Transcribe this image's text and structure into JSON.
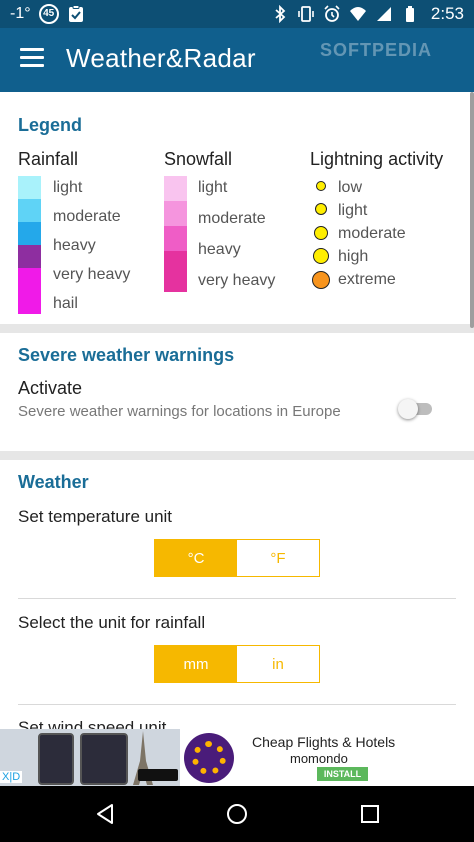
{
  "status_bar": {
    "temperature": "-1°",
    "notification_count": "45",
    "time": "2:53"
  },
  "app_bar": {
    "title": "Weather&Radar",
    "watermark": "SOFTPEDIA"
  },
  "legend": {
    "title": "Legend",
    "rainfall": {
      "title": "Rainfall",
      "items": [
        {
          "label": "light",
          "color": "#a9f2fb"
        },
        {
          "label": "moderate",
          "color": "#5fd3f6"
        },
        {
          "label": "heavy",
          "color": "#24a8ea"
        },
        {
          "label": "very heavy",
          "color": "#8e2ea0"
        },
        {
          "label": "hail",
          "color": "#f01ae8"
        }
      ]
    },
    "snowfall": {
      "title": "Snowfall",
      "items": [
        {
          "label": "light",
          "color": "#f9c4ef"
        },
        {
          "label": "moderate",
          "color": "#f595de"
        },
        {
          "label": "heavy",
          "color": "#ef5dc6"
        },
        {
          "label": "very heavy",
          "color": "#e5329f"
        }
      ]
    },
    "lightning": {
      "title": "Lightning activity",
      "items": [
        {
          "label": "low",
          "color": "#ffee00"
        },
        {
          "label": "light",
          "color": "#ffee00"
        },
        {
          "label": "moderate",
          "color": "#ffee00"
        },
        {
          "label": "high",
          "color": "#ffee00"
        },
        {
          "label": "extreme",
          "color": "#f7941d"
        }
      ]
    }
  },
  "warnings": {
    "title": "Severe weather warnings",
    "activate_label": "Activate",
    "activate_description": "Severe weather warnings for locations in Europe",
    "enabled": false
  },
  "weather": {
    "title": "Weather",
    "temperature": {
      "label": "Set temperature unit",
      "options": [
        "°C",
        "°F"
      ],
      "selected": "°C"
    },
    "rainfall": {
      "label": "Select the unit for rainfall",
      "options": [
        "mm",
        "in"
      ],
      "selected": "mm"
    },
    "wind_label": "Set wind speed unit"
  },
  "ad": {
    "headline": "Cheap Flights & Hotels",
    "brand": "momondo",
    "install_label": "INSTALL",
    "badge": "X|D"
  },
  "colors": {
    "status_bar": "#0d4f74",
    "app_bar": "#105f8d",
    "section_title": "#1a6d97",
    "accent": "#f6b800"
  },
  "icons": {
    "menu": "menu-icon",
    "bluetooth": "bluetooth-icon",
    "vibrate": "vibrate-icon",
    "alarm": "alarm-icon",
    "wifi": "wifi-icon",
    "signal": "signal-icon",
    "battery": "battery-icon",
    "back": "back-icon",
    "home": "home-icon",
    "recents": "recents-icon"
  }
}
